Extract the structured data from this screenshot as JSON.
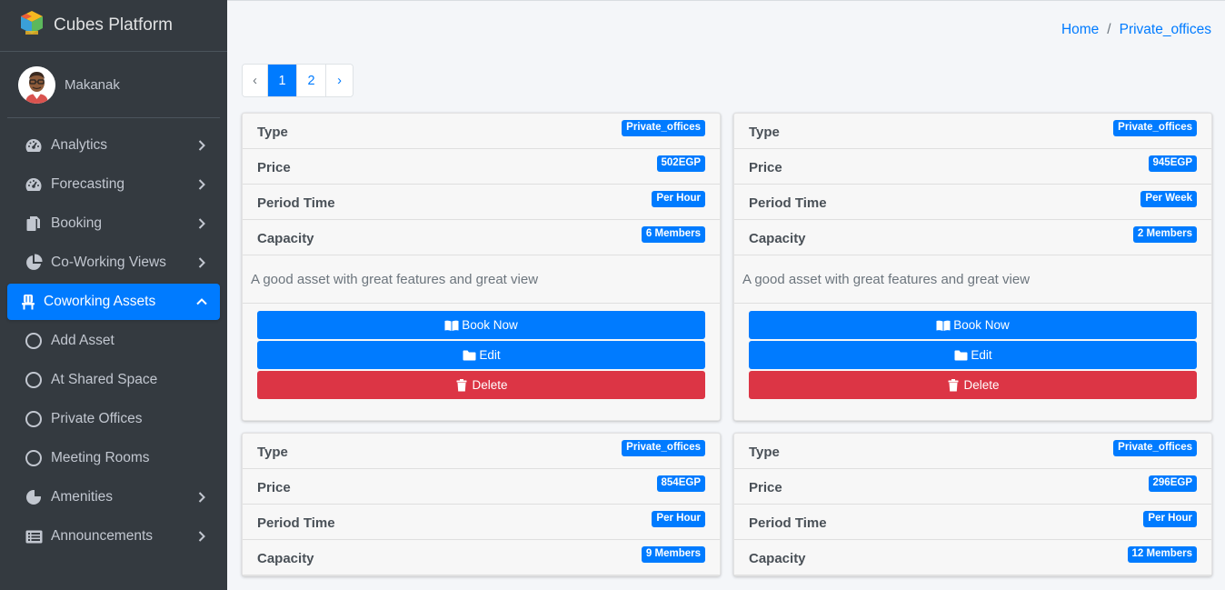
{
  "brand": {
    "name": "Cubes Platform"
  },
  "user": {
    "name": "Makanak"
  },
  "nav": {
    "items": [
      {
        "label": "Analytics",
        "icon": "tachometer-icon"
      },
      {
        "label": "Forecasting",
        "icon": "tachometer-icon"
      },
      {
        "label": "Booking",
        "icon": "copy-icon"
      },
      {
        "label": "Co-Working Views",
        "icon": "pie-chart-icon"
      },
      {
        "label": "Coworking Assets",
        "icon": "chair-icon",
        "active": true
      },
      {
        "label": "Add Asset",
        "icon": "circle-icon"
      },
      {
        "label": "At Shared Space",
        "icon": "circle-icon"
      },
      {
        "label": "Private Offices",
        "icon": "circle-icon"
      },
      {
        "label": "Meeting Rooms",
        "icon": "circle-icon"
      },
      {
        "label": "Amenities",
        "icon": "pie-icon"
      },
      {
        "label": "Announcements",
        "icon": "list-icon"
      }
    ]
  },
  "breadcrumb": {
    "home": "Home",
    "sep": "/",
    "current": "Private_offices"
  },
  "pagination": {
    "prev": "‹",
    "pages": [
      "1",
      "2"
    ],
    "next": "›",
    "active_page": "1"
  },
  "labels": {
    "type": "Type",
    "price": "Price",
    "period": "Period Time",
    "capacity": "Capacity"
  },
  "buttons": {
    "book": "Book Now",
    "edit": "Edit",
    "delete": "Delete"
  },
  "cards": [
    {
      "type": "Private_offices",
      "price": "502EGP",
      "period": "Per Hour",
      "capacity": "6 Members",
      "description": "A good asset with great features and great view"
    },
    {
      "type": "Private_offices",
      "price": "945EGP",
      "period": "Per Week",
      "capacity": "2 Members",
      "description": "A good asset with great features and great view"
    },
    {
      "type": "Private_offices",
      "price": "854EGP",
      "period": "Per Hour",
      "capacity": "9 Members",
      "description": ""
    },
    {
      "type": "Private_offices",
      "price": "296EGP",
      "period": "Per Hour",
      "capacity": "12 Members",
      "description": ""
    }
  ],
  "colors": {
    "sidebar": "#343a40",
    "primary": "#007bff",
    "danger": "#dc3545",
    "page_bg": "#f4f6f9"
  }
}
